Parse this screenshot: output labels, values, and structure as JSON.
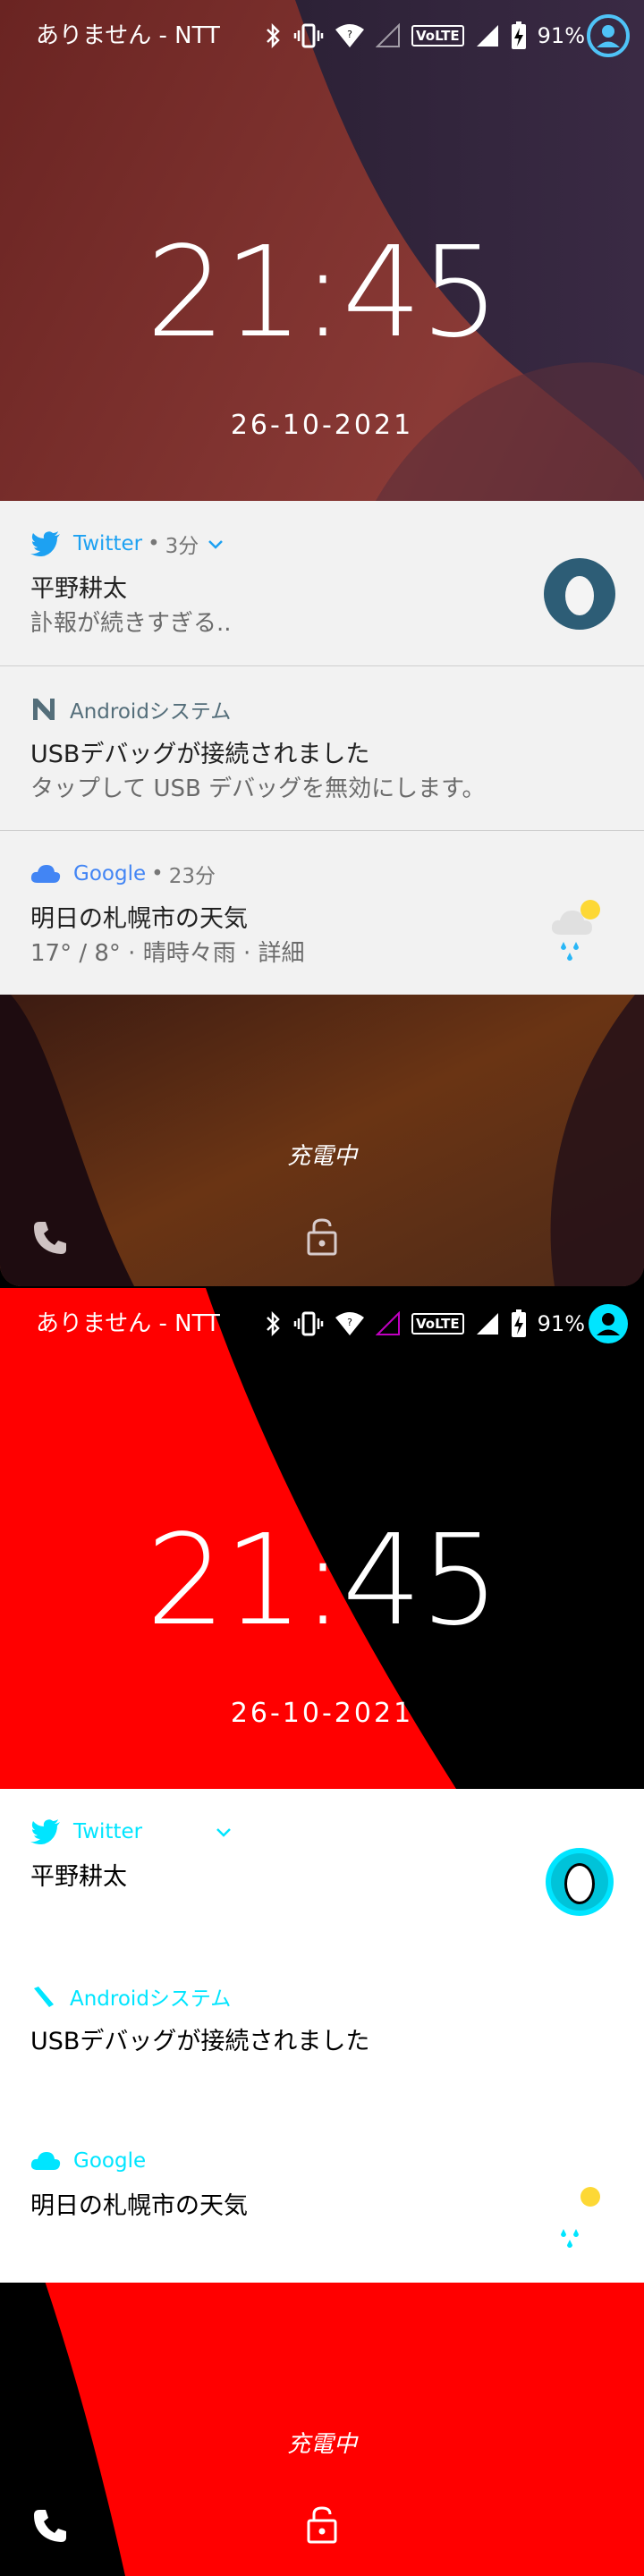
{
  "status_bar": {
    "carrier": "ありません - NTT",
    "battery_percent": "91%",
    "volte": "VoLTE"
  },
  "lockscreen": {
    "time": "21:45",
    "date": "26-10-2021",
    "charging": "充電中"
  },
  "notifications": [
    {
      "app": "Twitter",
      "dot": "•",
      "time": "3分",
      "title": "平野耕太",
      "text": "訃報が続きすぎる..",
      "icon": "twitter-bird-icon",
      "color": "#1da1f2"
    },
    {
      "app": "Androidシステム",
      "title": "USBデバッグが接続されました",
      "text": "タップして USB デバッグを無効にします。",
      "icon": "android-debug-icon",
      "color": "#546e7a"
    },
    {
      "app": "Google",
      "dot": "•",
      "time": "23分",
      "title": "明日の札幌市の天気",
      "text": "17° / 8° · 晴時々雨 · 詳細",
      "icon": "cloud-icon",
      "color": "#4285f4"
    }
  ],
  "colors": {
    "accent_cyan": "#00e5ff",
    "alt_red": "#ff0000",
    "panel_light": "#f2f2f2"
  }
}
